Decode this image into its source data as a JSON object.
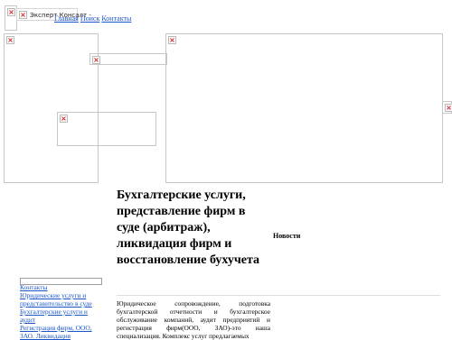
{
  "header": {
    "logo_alt": "Эксперт Консалт -",
    "nav": [
      {
        "label": "Главная"
      },
      {
        "label": "Поиск"
      },
      {
        "label": "Контакты"
      }
    ]
  },
  "sidebar": {
    "links": [
      {
        "label": "Контакты"
      },
      {
        "label": "Юридические услуги и представительство в суде"
      },
      {
        "label": "Бухгалтерские услуги и аудит"
      },
      {
        "label": "Регистрация фирм, ООО, ЗАО. Ликвидация"
      }
    ]
  },
  "main": {
    "title": "Бухгалтерские услуги, представление фирм в суде (арбитраж), ликвидация фирм и восстановление бухучета",
    "news_heading": "Новости",
    "body": "Юридическое сопровождение, подготовка бухгалтерской отчетности и бухгалтерское обслуживание компаний, аудит предприятий и регистрация фирм(ООО, ЗАО)-это наша специализация. Комплекс услуг предлагаемых"
  },
  "icons": {
    "broken_image": "broken-image-icon"
  }
}
